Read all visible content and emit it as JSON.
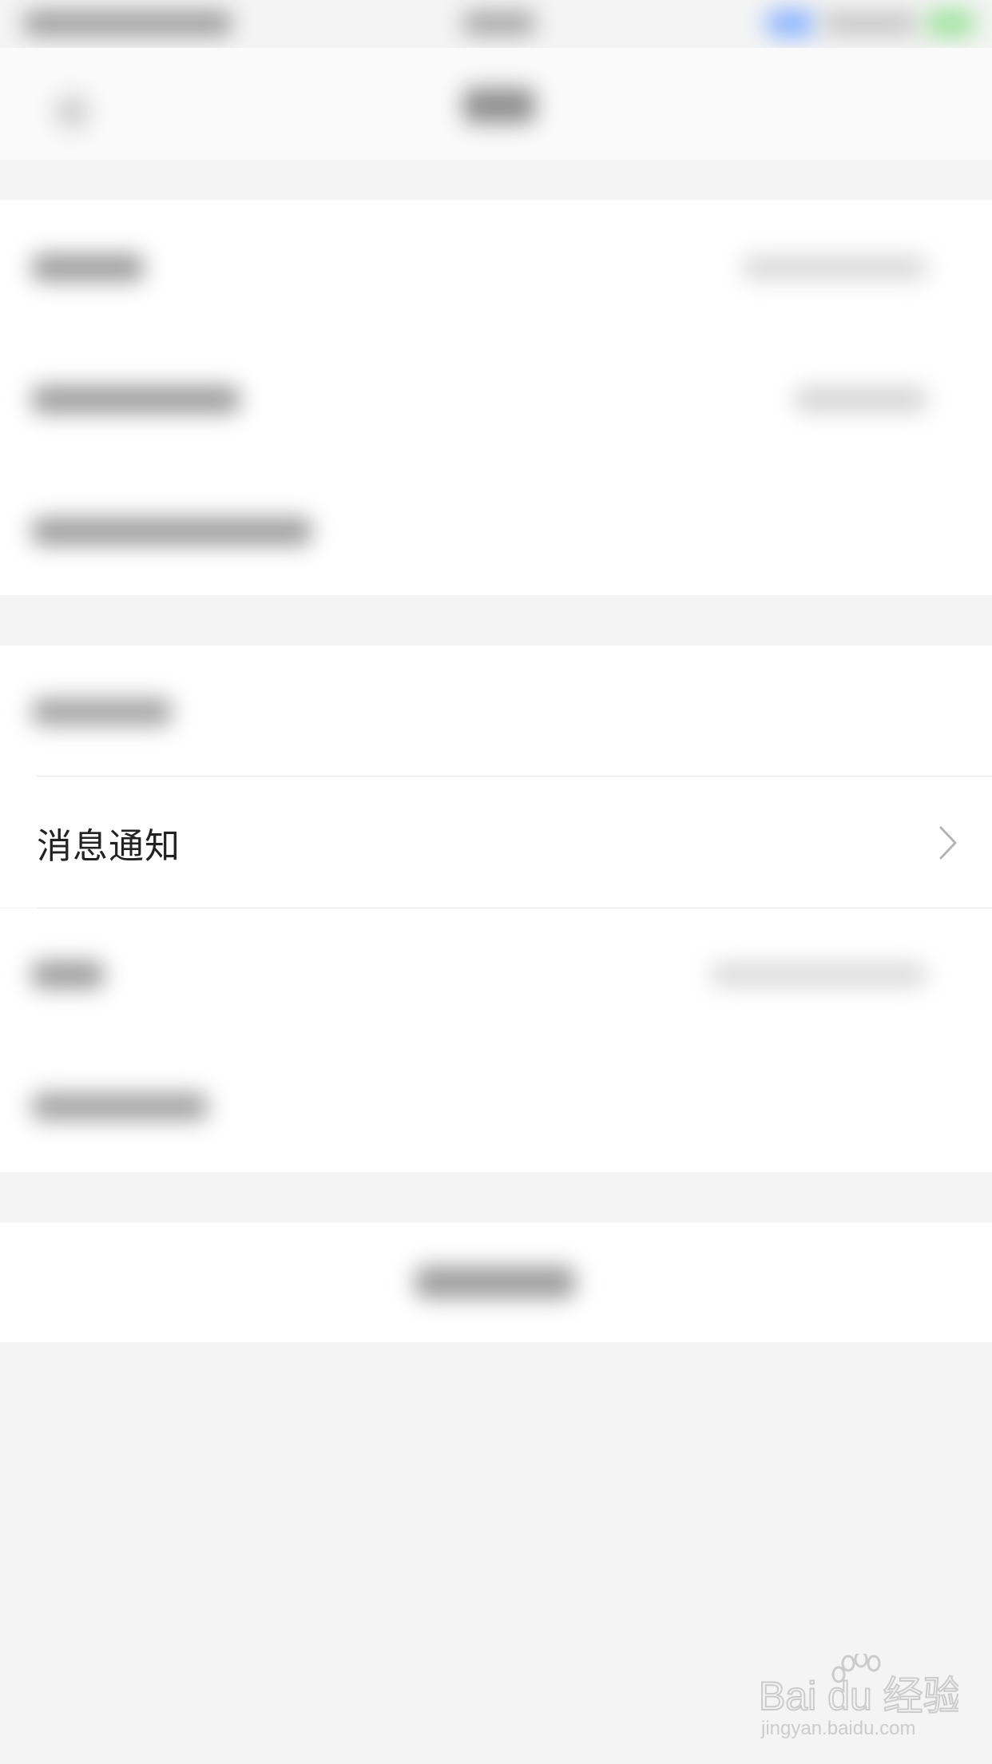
{
  "settings": {
    "notification_row": {
      "label": "消息通知"
    }
  },
  "watermark": {
    "brand": "Bai du 经验",
    "url": "jingyan.baidu.com"
  },
  "colors": {
    "background": "#f4f4f4",
    "row_background": "#ffffff",
    "text": "#222222",
    "chevron": "#b4b4b4"
  }
}
